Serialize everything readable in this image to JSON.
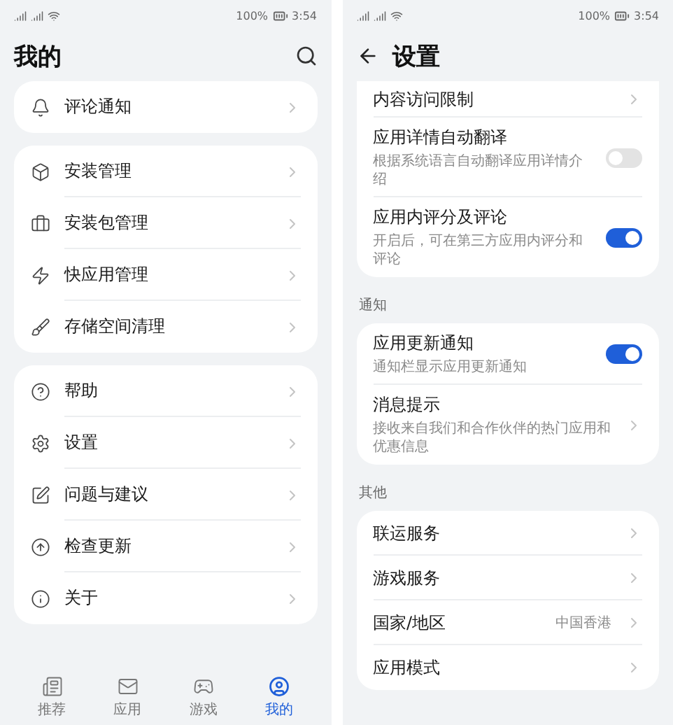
{
  "left_screen": {
    "status_bar": {
      "battery": "100%",
      "time": "3:54"
    },
    "title": "我的",
    "groups": [
      {
        "items": [
          {
            "label": "评论通知"
          }
        ]
      },
      {
        "items": [
          {
            "label": "安装管理"
          },
          {
            "label": "安装包管理"
          },
          {
            "label": "快应用管理"
          },
          {
            "label": "存储空间清理"
          }
        ]
      },
      {
        "items": [
          {
            "label": "帮助"
          },
          {
            "label": "设置"
          },
          {
            "label": "问题与建议"
          },
          {
            "label": "检查更新"
          },
          {
            "label": "关于"
          }
        ]
      }
    ],
    "bottom_nav": [
      {
        "label": "推荐",
        "selected": false
      },
      {
        "label": "应用",
        "selected": false
      },
      {
        "label": "游戏",
        "selected": false
      },
      {
        "label": "我的",
        "selected": true
      }
    ]
  },
  "right_screen": {
    "status_bar": {
      "battery": "100%",
      "time": "3:54"
    },
    "title": "设置",
    "sections": [
      {
        "items": [
          {
            "kind": "chevron",
            "label": "内容访问限制"
          },
          {
            "kind": "toggle",
            "label": "应用详情自动翻译",
            "description": "根据系统语言自动翻译应用详情介绍",
            "on": false
          },
          {
            "kind": "toggle",
            "label": "应用内评分及评论",
            "description": "开启后，可在第三方应用内评分和评论",
            "on": true
          }
        ]
      },
      {
        "header": "通知",
        "items": [
          {
            "kind": "toggle",
            "label": "应用更新通知",
            "description": "通知栏显示应用更新通知",
            "on": true
          },
          {
            "kind": "chevron",
            "label": "消息提示",
            "description": "接收来自我们和合作伙伴的热门应用和优惠信息"
          }
        ]
      },
      {
        "header": "其他",
        "items": [
          {
            "kind": "chevron",
            "label": "联运服务"
          },
          {
            "kind": "chevron",
            "label": "游戏服务"
          },
          {
            "kind": "chevron",
            "label": "国家/地区",
            "value": "中国香港"
          },
          {
            "kind": "chevron",
            "label": "应用模式"
          }
        ]
      }
    ]
  }
}
